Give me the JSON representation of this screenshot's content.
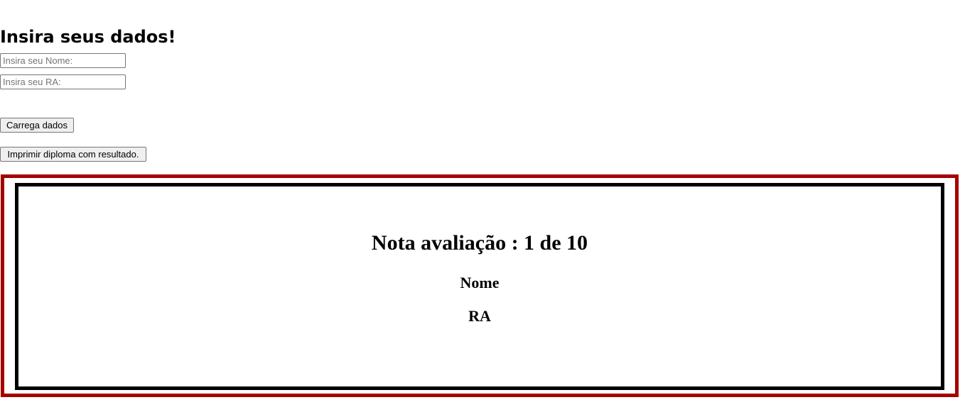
{
  "form": {
    "title": "Insira seus dados!",
    "nome_input": {
      "value": "",
      "placeholder": "Insira seu Nome:"
    },
    "ra_input": {
      "value": "",
      "placeholder": "Insira seu RA:"
    },
    "carrega_button_label": "Carrega dados",
    "imprimir_button_label": "Imprimir diploma com resultado."
  },
  "diploma": {
    "nota_text": "Nota avaliação : 1 de 10",
    "nome_text": "Nome",
    "ra_text": "RA",
    "colors": {
      "outer_border": "#a50000",
      "inner_border": "#000000"
    }
  }
}
